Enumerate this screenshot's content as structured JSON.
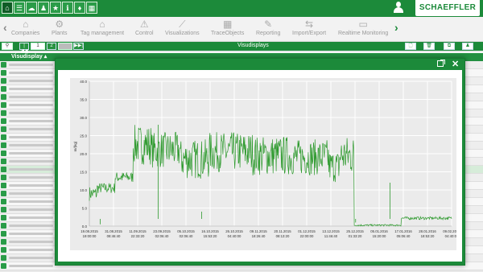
{
  "header": {
    "top_icons": [
      "home-icon",
      "list-icon",
      "cloud-icon",
      "user-icon",
      "star-icon",
      "info-icon",
      "bulb-icon",
      "calendar-icon"
    ],
    "logo_text": "SCHAEFFLER",
    "brand_color": "#1c8a3a"
  },
  "nav": {
    "items": [
      {
        "label": "Companies",
        "icon": "home-icon"
      },
      {
        "label": "Plants",
        "icon": "gear-icon"
      },
      {
        "label": "Tag management",
        "icon": "tag-icon"
      },
      {
        "label": "Control",
        "icon": "warning-icon"
      },
      {
        "label": "Visualizations",
        "icon": "chart-icon"
      },
      {
        "label": "TraceObjects",
        "icon": "grid-icon"
      },
      {
        "label": "Reporting",
        "icon": "report-icon"
      },
      {
        "label": "Import/Export",
        "icon": "import-icon"
      },
      {
        "label": "Realtime Monitoring",
        "icon": "monitor-icon"
      }
    ]
  },
  "pager": {
    "first": "|◀◀",
    "page1": "1",
    "page2": "2",
    "last": "▶▶|",
    "title": "Visudisplays"
  },
  "table": {
    "column_header": "Visudisplay ▴"
  },
  "chart_data": {
    "type": "line",
    "ylabel": "m/(kg)",
    "ylim": [
      0,
      40
    ],
    "y_ticks": [
      "0.0",
      "5.0",
      "10.0",
      "15.0",
      "20.0",
      "25.0",
      "30.0",
      "35.0",
      "40.0"
    ],
    "x_ticks": [
      [
        "19.08.2015",
        "19:00:00"
      ],
      [
        "31.08.2015",
        "08:46:40"
      ],
      [
        "11.09.2015",
        "22:33:20"
      ],
      [
        "23.09.2015",
        "02:06:40"
      ],
      [
        "05.10.2015",
        "02:06:40"
      ],
      [
        "16.10.2015",
        "15:53:20"
      ],
      [
        "26.10.2015",
        "04:40:00"
      ],
      [
        "09.11.2015",
        "18:26:40"
      ],
      [
        "20.11.2015",
        "08:13:20"
      ],
      [
        "01.12.2015",
        "22:00:00"
      ],
      [
        "13.12.2015",
        "11:46:40"
      ],
      [
        "25.12.2015",
        "01:33:20"
      ],
      [
        "05.01.2016",
        "15:20:00"
      ],
      [
        "17.01.2016",
        "05:06:40"
      ],
      [
        "28.01.2016",
        "18:53:20"
      ],
      [
        "09.02.2016",
        "04:40:00"
      ]
    ],
    "series": [
      {
        "color": "#2e9a2e",
        "segments": [
          {
            "t0": 0.0,
            "t1": 0.02,
            "lo": 7,
            "hi": 11
          },
          {
            "t0": 0.02,
            "t1": 0.07,
            "lo": 9,
            "hi": 12
          },
          {
            "t0": 0.07,
            "t1": 0.12,
            "lo": 12,
            "hi": 15
          },
          {
            "t0": 0.12,
            "t1": 0.17,
            "lo": 17,
            "hi": 28
          },
          {
            "t0": 0.17,
            "t1": 0.25,
            "lo": 16,
            "hi": 26
          },
          {
            "t0": 0.25,
            "t1": 0.33,
            "lo": 13,
            "hi": 24
          },
          {
            "t0": 0.33,
            "t1": 0.45,
            "lo": 15,
            "hi": 26
          },
          {
            "t0": 0.45,
            "t1": 0.55,
            "lo": 14,
            "hi": 25
          },
          {
            "t0": 0.55,
            "t1": 0.66,
            "lo": 14,
            "hi": 24
          },
          {
            "t0": 0.66,
            "t1": 0.69,
            "lo": 12,
            "hi": 21
          },
          {
            "t0": 0.69,
            "t1": 0.73,
            "lo": 14,
            "hi": 25
          },
          {
            "t0": 0.73,
            "t1": 0.86,
            "lo": 0,
            "hi": 0.5
          },
          {
            "t0": 0.86,
            "t1": 1.0,
            "lo": 1.8,
            "hi": 2.6
          }
        ]
      }
    ]
  }
}
